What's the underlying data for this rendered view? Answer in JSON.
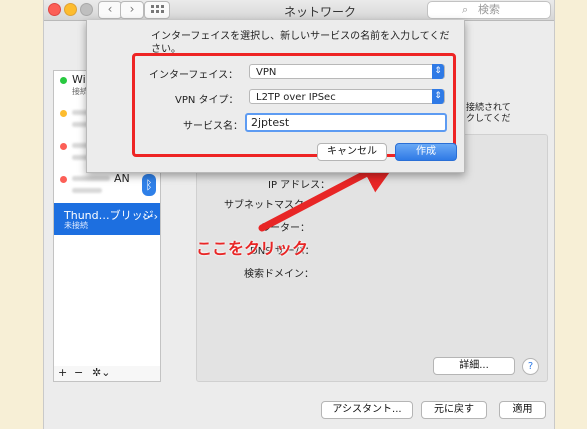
{
  "window": {
    "title": "ネットワーク",
    "search_placeholder": "検索",
    "back_icon": "chevron-left-icon",
    "forward_icon": "chevron-right-icon"
  },
  "sidebar": {
    "services": [
      {
        "name": "Wi-Fi",
        "status": "接続済み",
        "status_color": "#28c940"
      },
      {
        "name": "",
        "status": "",
        "status_color": "#fdbc2e"
      },
      {
        "name": "",
        "status": "",
        "status_color": "#fc5f57"
      },
      {
        "name": "",
        "name_suffix": "AN",
        "status": "",
        "status_color": "#fc5f57"
      },
      {
        "name": "Thund…ブリッジ",
        "status": "未接続",
        "status_color": "#fc5f57"
      }
    ],
    "tools": {
      "add": "+",
      "remove": "−",
      "gear": "✲⌄"
    }
  },
  "background_partial": {
    "right_text_1": "ら接続されて",
    "right_text_2": "ックしてくだ",
    "popup_arrow": "⌃⌄"
  },
  "detail": {
    "ip_label": "IP アドレス：",
    "subnet_label": "サブネットマスク：",
    "router_label": "ルーター：",
    "dns_label": "DNS サーバ：",
    "search_domain_label": "検索ドメイン：",
    "advanced_button": "詳細...",
    "help_button": "?"
  },
  "footer": {
    "assistant_button": "アシスタント...",
    "revert_button": "元に戻す",
    "apply_button": "適用"
  },
  "sheet": {
    "instruction": "インターフェイスを選択し、新しいサービスの名前を入力してください。",
    "interface_label": "インターフェイス：",
    "interface_value": "VPN",
    "vpn_type_label": "VPN タイプ：",
    "vpn_type_value": "L2TP over IPSec",
    "service_name_label": "サービス名：",
    "service_name_value": "2jptest",
    "cancel_button": "キャンセル",
    "create_button": "作成"
  },
  "annotation": {
    "text": "ここをクリック",
    "color": "#e82626"
  }
}
